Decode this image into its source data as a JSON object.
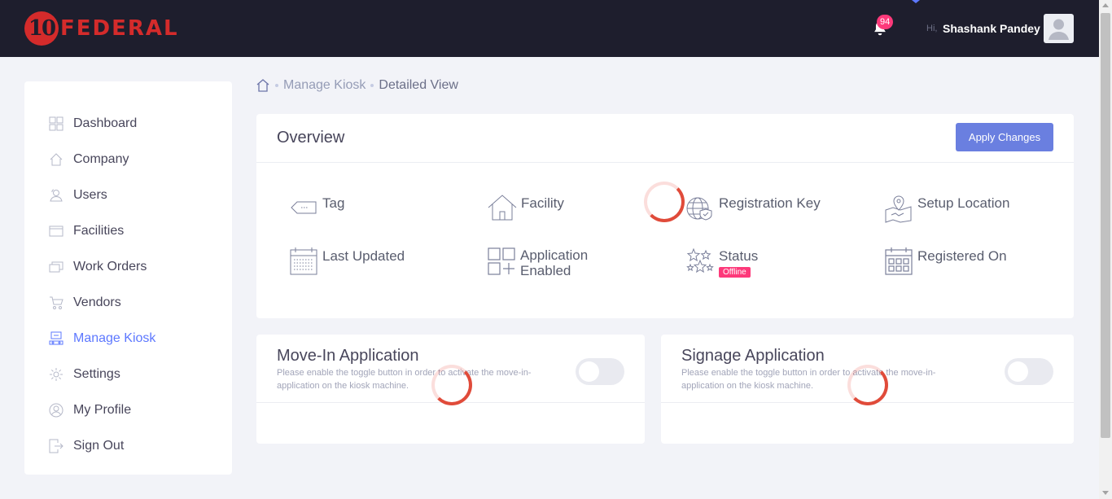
{
  "header": {
    "logo_number": "10",
    "logo_text": "FEDERAL",
    "notification_count": "94",
    "greeting": "Hi,",
    "user_name": "Shashank Pandey",
    "icons": {
      "notifications": "bell-icon",
      "avatar": "user-avatar-icon"
    }
  },
  "sidebar": {
    "items": [
      {
        "label": "Dashboard",
        "icon": "dashboard-grid-icon",
        "active": false
      },
      {
        "label": "Company",
        "icon": "home-icon",
        "active": false
      },
      {
        "label": "Users",
        "icon": "users-icon",
        "active": false
      },
      {
        "label": "Facilities",
        "icon": "facilities-icon",
        "active": false
      },
      {
        "label": "Work Orders",
        "icon": "work-orders-icon",
        "active": false
      },
      {
        "label": "Vendors",
        "icon": "cart-icon",
        "active": false
      },
      {
        "label": "Manage Kiosk",
        "icon": "kiosk-icon",
        "active": true
      },
      {
        "label": "Settings",
        "icon": "gear-icon",
        "active": false
      },
      {
        "label": "My Profile",
        "icon": "profile-icon",
        "active": false
      },
      {
        "label": "Sign Out",
        "icon": "sign-out-icon",
        "active": false
      }
    ]
  },
  "breadcrumb": {
    "home_icon": "home-icon",
    "items": [
      "Manage Kiosk",
      "Detailed View"
    ]
  },
  "overview": {
    "title": "Overview",
    "apply_button": "Apply Changes",
    "fields": {
      "tag": {
        "label": "Tag",
        "icon": "tag-icon"
      },
      "facility": {
        "label": "Facility",
        "icon": "home-icon"
      },
      "registration_key": {
        "label": "Registration Key",
        "icon": "globe-shield-icon"
      },
      "setup_location": {
        "label": "Setup Location",
        "icon": "map-pin-icon"
      },
      "last_updated": {
        "label": "Last Updated",
        "icon": "calendar-icon"
      },
      "application_enabled": {
        "label_line1": "Application",
        "label_line2": "Enabled",
        "icon": "apps-plus-icon"
      },
      "status": {
        "label": "Status",
        "value": "Offline",
        "icon": "stars-icon"
      },
      "registered_on": {
        "label": "Registered On",
        "icon": "calendar-grid-icon"
      }
    }
  },
  "move_in_application": {
    "title": "Move-In Application",
    "description": "Please enable the toggle button in order to activate the move-in-application on the kiosk machine.",
    "enabled": false
  },
  "signage_application": {
    "title": "Signage Application",
    "description": "Please enable the toggle button in order to activate the move-in-application on the kiosk machine.",
    "enabled": false
  },
  "colors": {
    "header_bg": "#1e1e2d",
    "logo_red": "#d42b2b",
    "accent": "#5d78ff",
    "button": "#6a7fe0",
    "badge_pink": "#fd397a",
    "spinner_red": "#e04b3a"
  }
}
